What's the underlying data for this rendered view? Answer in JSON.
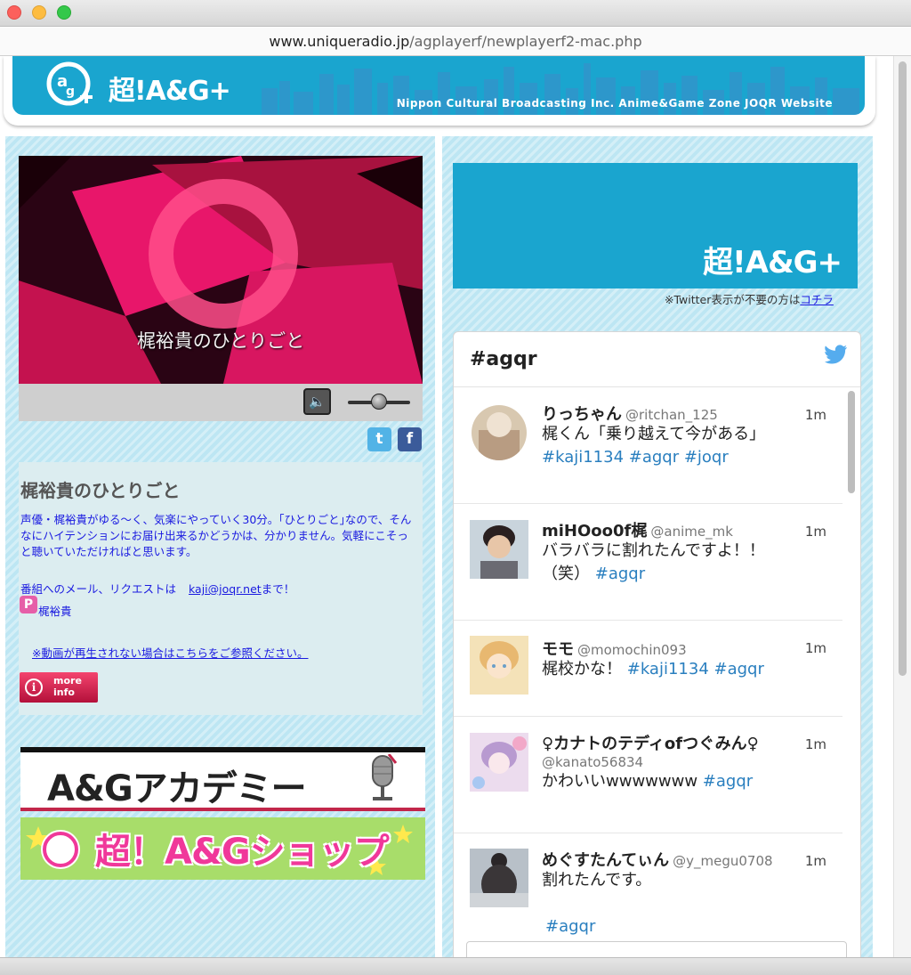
{
  "browser": {
    "url_host": "www.uniqueradio.jp",
    "url_path": "/agplayerf/newplayerf2-mac.php"
  },
  "header": {
    "logo_text": "超!A&G+",
    "subtitle": "Nippon Cultural Broadcasting Inc. Anime&Game Zone JOQR Website"
  },
  "player": {
    "caption": "梶裕貴のひとりごと",
    "volume_icon": "speaker-icon",
    "volume_level": 0.5
  },
  "social": {
    "twitter_glyph": "t",
    "facebook_glyph": "f"
  },
  "program": {
    "title": "梶裕貴のひとりごと",
    "description": "声優・梶裕貴がゆる〜く、気楽にやっていく30分。｢ひとりごと｣なので、そんなにハイテンションにお届け出来るかどうかは、分かりません。気軽にこそっと聴いていただければと思います。",
    "mail_label": "番組へのメール、リクエストは",
    "mail_address": "kaji@joqr.net",
    "mail_suffix": "まで！",
    "personality_badge": "P",
    "personality": "梶裕貴",
    "help_link": "※動画が再生されない場合はこちらをご参照ください。",
    "more_info_line1": "more",
    "more_info_line2": "info"
  },
  "banners": {
    "academy": "A&Gアカデミー",
    "shop": "超！A&Gショップ"
  },
  "promo": {
    "logo_text": "超!A&G+"
  },
  "twitter": {
    "note_text": "※Twitter表示が不要の方は",
    "note_link": "コチラ",
    "hashtag_title": "#agqr",
    "tweets": [
      {
        "name": "りっちゃん",
        "handle": "@ritchan_125",
        "time": "1m",
        "text": "梶くん「乗り越えて今がある」",
        "tags": "#kaji1134 #agqr #joqr"
      },
      {
        "name": "miHOoo0f梶",
        "handle": "@anime_mk",
        "time": "1m",
        "text": "バラバラに割れたんですよ！！（笑）",
        "tags": "#agqr"
      },
      {
        "name": "モモ",
        "handle": "@momochin093",
        "time": "1m",
        "text": "梶校かな！",
        "tags": "#kaji1134 #agqr"
      },
      {
        "name": "♀カナトのテディofつぐみん♀",
        "handle": "@kanato56834",
        "time": "1m",
        "text": "かわいいwwwwwww",
        "tags": "#agqr"
      },
      {
        "name": "めぐすたんてぃん",
        "handle": "@y_megu0708",
        "time": "1m",
        "text": "割れたんです。",
        "tags": "#agqr"
      }
    ]
  },
  "colors": {
    "brand_blue": "#1aa5cf",
    "link_blue": "#1a1ae0",
    "hashtag_blue": "#2a7fbf",
    "accent_pink": "#e8166a"
  }
}
